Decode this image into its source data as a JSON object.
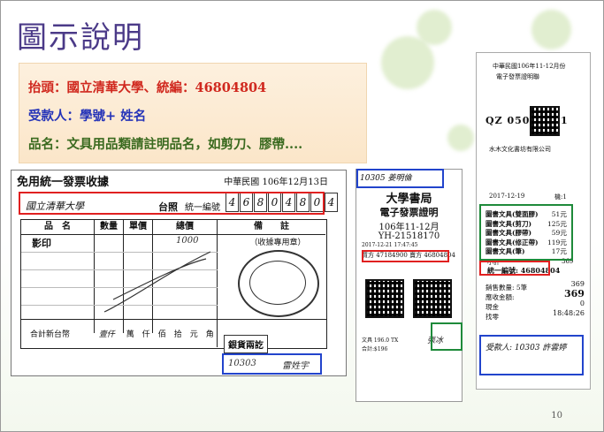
{
  "slide": {
    "title": "圖示說明",
    "page_number": "10",
    "lines": [
      "抬頭：國立清華大學、統編：46804804",
      "受款人：學號+ 姓名",
      "品名：文具用品類請註明品名，如剪刀、膠帶...."
    ],
    "colors": {
      "title": "#4b3a88",
      "line1": "#d0281e",
      "line2": "#2433b8",
      "line3": "#3a6a1f",
      "box_red": "#e02020",
      "box_blue": "#2244cc",
      "box_green": "#1e8a3a"
    }
  },
  "receipt1": {
    "header": "免用統一發票收據",
    "date_prefix": "中華民國",
    "date_value": "106年12月13日",
    "buyer": "國立清華大學",
    "taipei": "台照",
    "tax_label": "統一編號",
    "tax_digits": [
      "4",
      "6",
      "8",
      "0",
      "4",
      "8",
      "0",
      "4"
    ],
    "columns": [
      "品　名",
      "數量",
      "單價",
      "總價",
      "備　　註"
    ],
    "item": "影印",
    "item_amount": "1000",
    "stamp_label": "（收據專用章）",
    "money_label": "銀貨兩訖",
    "total_label": "合計新台幣",
    "total_hand": "壹仟",
    "total_units": "萬　仟　佰　拾　元　角",
    "payee": "10303",
    "payee_name": "雷姓宇"
  },
  "receipt2": {
    "note": "10305 姜明倫",
    "shop": "大學書局",
    "einv_title": "電子發票證明",
    "period": "106年11-12月",
    "number": "YH-21518170",
    "datetime": "2017-12-21 17:47:45",
    "buyer_id": "買方 47184900",
    "seller_id": "賣方 46804804",
    "items": "文具  196.0 TX",
    "subtotal": "合計:$196",
    "signature": "張冰"
  },
  "receipt3": {
    "title": "中華民國106年11-12月份",
    "subtitle": "電子發票證明聯",
    "inv_no": "QZ 05010791",
    "shop": "水木文化書坊有限公司",
    "date": "2017-12-19",
    "counter": "機:1",
    "goods": [
      "圖書文具(雙面膠)",
      "圖書文具(剪刀)",
      "圖書文具(膠帶)",
      "圖書文具(修正帶)",
      "圖書文具(筆)"
    ],
    "amounts": [
      "51元",
      "125元",
      "59元",
      "119元",
      "17元"
    ],
    "subtotal_label": "小計",
    "subtotal_value": "369",
    "tax_no": "統一編號: 46804804",
    "summary": [
      "銷售數量: 5筆",
      "應收金額:",
      "現金",
      "找零"
    ],
    "summary_vals": [
      "369",
      "369",
      "0",
      "18:48:26"
    ],
    "payee": "受款人: 10303 許雲婷"
  }
}
